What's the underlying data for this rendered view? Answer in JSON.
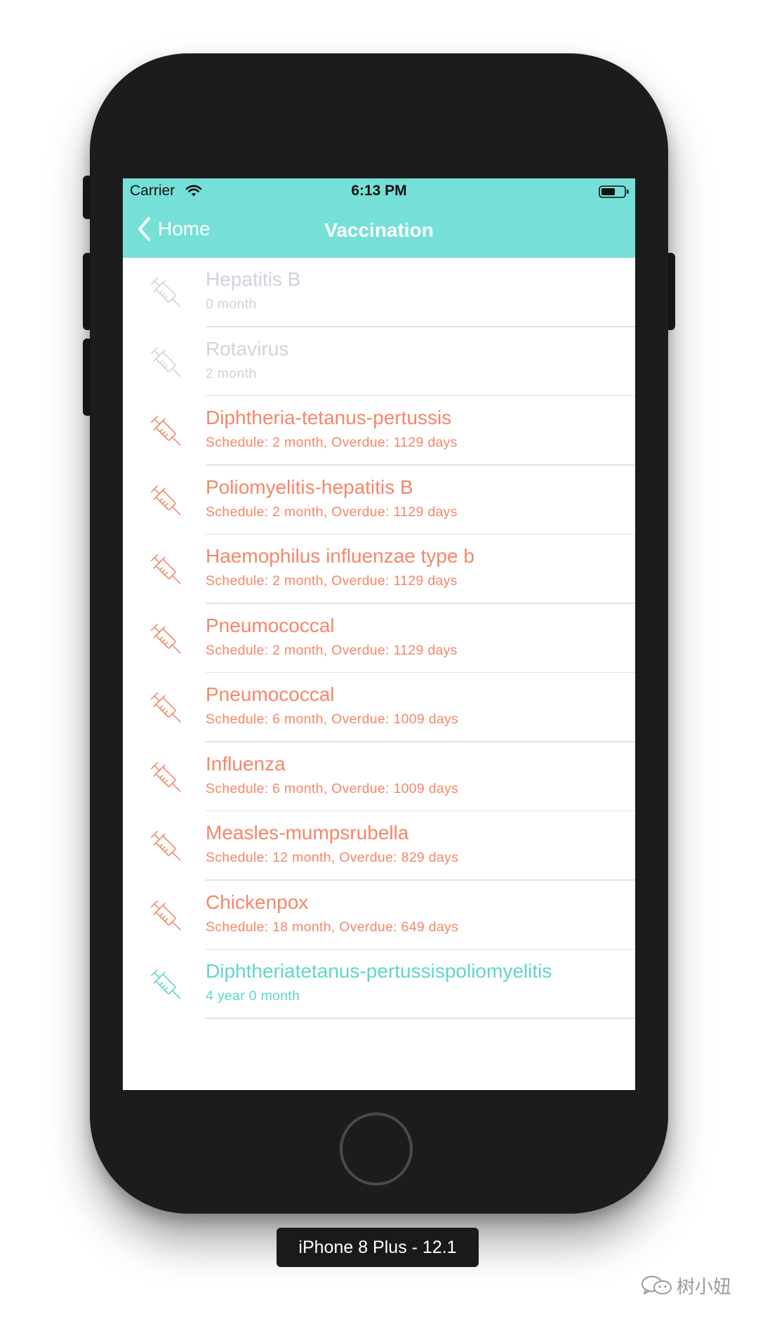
{
  "status_bar": {
    "carrier": "Carrier",
    "time": "6:13 PM"
  },
  "nav": {
    "back_label": "Home",
    "title": "Vaccination"
  },
  "colors": {
    "header": "#76e0d8",
    "done": "#cfd3db",
    "overdue": "#f4876a",
    "upcoming": "#5fd6cc"
  },
  "vaccines": [
    {
      "name": "Hepatitis B",
      "detail": "0 month",
      "status": "done",
      "icon": "syringe-icon"
    },
    {
      "name": "Rotavirus",
      "detail": "2 month",
      "status": "done",
      "icon": "syringe-icon"
    },
    {
      "name": "Diphtheria-tetanus-pertussis",
      "detail": "Schedule: 2 month, Overdue: 1129 days",
      "status": "overdue",
      "icon": "syringe-icon"
    },
    {
      "name": "Poliomyelitis-hepatitis B",
      "detail": "Schedule: 2 month, Overdue: 1129 days",
      "status": "overdue",
      "icon": "syringe-icon"
    },
    {
      "name": "Haemophilus influenzae type b",
      "detail": "Schedule: 2 month, Overdue: 1129 days",
      "status": "overdue",
      "icon": "syringe-icon"
    },
    {
      "name": "Pneumococcal",
      "detail": "Schedule: 2 month, Overdue: 1129 days",
      "status": "overdue",
      "icon": "syringe-icon"
    },
    {
      "name": "Pneumococcal",
      "detail": "Schedule: 6 month, Overdue: 1009 days",
      "status": "overdue",
      "icon": "syringe-icon"
    },
    {
      "name": "Influenza",
      "detail": "Schedule: 6 month, Overdue: 1009 days",
      "status": "overdue",
      "icon": "syringe-icon"
    },
    {
      "name": "Measles-mumpsrubella",
      "detail": "Schedule: 12 month, Overdue: 829 days",
      "status": "overdue",
      "icon": "syringe-icon"
    },
    {
      "name": "Chickenpox",
      "detail": "Schedule: 18 month, Overdue: 649 days",
      "status": "overdue",
      "icon": "syringe-icon"
    },
    {
      "name": "Diphtheriatetanus-pertussispoliomyelitis",
      "detail": "4 year 0 month",
      "status": "upcoming",
      "icon": "syringe-icon"
    }
  ],
  "device_label": "iPhone 8 Plus - 12.1",
  "watermark": "树小妞"
}
